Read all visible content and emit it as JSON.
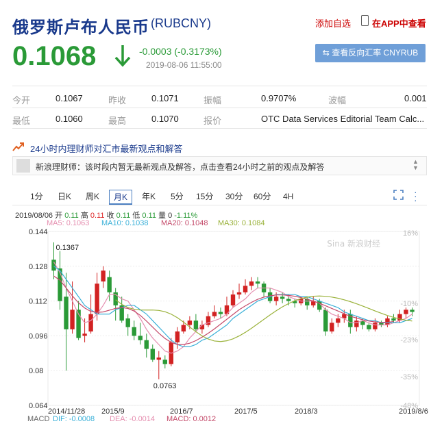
{
  "header": {
    "title": "俄罗斯卢布人民币",
    "code": "(RUBCNY)",
    "add_watch": "添加自选",
    "app_view": "在APP中查看"
  },
  "quote": {
    "price": "0.1068",
    "change": "-0.0003 (-0.3173%)",
    "time": "2019-08-06 11:55:00",
    "reverse_button": "查看反向汇率 CNYRUB"
  },
  "stats": {
    "row1": [
      {
        "label": "今开",
        "value": "0.1067"
      },
      {
        "label": "昨收",
        "value": "0.1071"
      },
      {
        "label": "振幅",
        "value": "0.9707%"
      },
      {
        "label": "波幅",
        "value": "0.001"
      }
    ],
    "row2": [
      {
        "label": "最低",
        "value": "0.1060"
      },
      {
        "label": "最高",
        "value": "0.1070"
      },
      {
        "label": "报价",
        "value": "OTC Data Services Editorial Team Calc..."
      }
    ]
  },
  "news": {
    "heading": "24小时内理财师对汇市最新观点和解答",
    "text": "新浪理财师：该时段内暂无最新观点及解答，点击查看24小时之前的观点及解答"
  },
  "tabs": [
    "1分",
    "日K",
    "周K",
    "月K",
    "年K",
    "5分",
    "15分",
    "30分",
    "60分",
    "4H"
  ],
  "active_tab": "月K",
  "ohlc": {
    "date": "2019/08/06",
    "open_label": "开",
    "open": "0.11",
    "high_label": "高",
    "high": "0.11",
    "close_label": "收",
    "close": "0.11",
    "low_label": "低",
    "low": "0.11",
    "vol_label": "量",
    "vol": "0",
    "pct": "-1.11%"
  },
  "ma": [
    {
      "label": "MA5: 0.1063",
      "color": "#e58fb0"
    },
    {
      "label": "MA10: 0.1038",
      "color": "#3ab0d8"
    },
    {
      "label": "MA20: 0.1048",
      "color": "#c44a6a"
    },
    {
      "label": "MA30: 0.1084",
      "color": "#9ab23a"
    }
  ],
  "macd": {
    "label": "MACD",
    "dif": "DIF: -0.0008",
    "dea": "DEA: -0.0014",
    "macd": "MACD: 0.0012"
  },
  "watermark": "新浪财经",
  "colors": {
    "up": "#d22222",
    "down": "#2a9a37",
    "accent": "#1a3a8c"
  },
  "chart_data": {
    "type": "candlestick",
    "y_ticks": [
      "0.144",
      "0.128",
      "0.112",
      "0.096",
      "0.08",
      "0.064"
    ],
    "y_range": [
      0.064,
      0.144
    ],
    "pct_ticks": [
      "16%",
      "-10%",
      "-23%",
      "-35%",
      "-48%"
    ],
    "x_ticks": [
      "2014/11/28",
      "2015/9",
      "2016/7",
      "2017/5",
      "2018/3",
      "2019/8/6"
    ],
    "annotations": [
      {
        "label": "0.1367",
        "value": 0.1367
      },
      {
        "label": "0.0763",
        "value": 0.0763
      }
    ],
    "candles": [
      [
        0.131,
        0.126,
        0.139,
        0.122
      ],
      [
        0.127,
        0.112,
        0.135,
        0.108
      ],
      [
        0.114,
        0.099,
        0.125,
        0.08
      ],
      [
        0.099,
        0.108,
        0.121,
        0.097
      ],
      [
        0.108,
        0.095,
        0.112,
        0.094
      ],
      [
        0.096,
        0.097,
        0.104,
        0.093
      ],
      [
        0.098,
        0.106,
        0.115,
        0.097
      ],
      [
        0.106,
        0.12,
        0.125,
        0.103
      ],
      [
        0.121,
        0.126,
        0.128,
        0.118
      ],
      [
        0.123,
        0.116,
        0.126,
        0.112
      ],
      [
        0.116,
        0.11,
        0.118,
        0.103
      ],
      [
        0.11,
        0.103,
        0.114,
        0.102
      ],
      [
        0.104,
        0.1,
        0.106,
        0.096
      ],
      [
        0.1,
        0.096,
        0.103,
        0.094
      ],
      [
        0.096,
        0.094,
        0.102,
        0.092
      ],
      [
        0.094,
        0.09,
        0.097,
        0.086
      ],
      [
        0.09,
        0.085,
        0.092,
        0.084
      ],
      [
        0.085,
        0.086,
        0.089,
        0.076
      ],
      [
        0.085,
        0.083,
        0.087,
        0.081
      ],
      [
        0.083,
        0.093,
        0.095,
        0.082
      ],
      [
        0.093,
        0.098,
        0.1,
        0.09
      ],
      [
        0.098,
        0.101,
        0.103,
        0.097
      ],
      [
        0.101,
        0.103,
        0.105,
        0.099
      ],
      [
        0.103,
        0.099,
        0.106,
        0.098
      ],
      [
        0.099,
        0.101,
        0.103,
        0.097
      ],
      [
        0.101,
        0.105,
        0.107,
        0.1
      ],
      [
        0.105,
        0.107,
        0.11,
        0.104
      ],
      [
        0.107,
        0.106,
        0.109,
        0.104
      ],
      [
        0.106,
        0.11,
        0.114,
        0.105
      ],
      [
        0.11,
        0.115,
        0.117,
        0.109
      ],
      [
        0.115,
        0.116,
        0.12,
        0.113
      ],
      [
        0.116,
        0.119,
        0.122,
        0.115
      ],
      [
        0.119,
        0.121,
        0.123,
        0.117
      ],
      [
        0.121,
        0.12,
        0.123,
        0.118
      ],
      [
        0.12,
        0.116,
        0.121,
        0.114
      ],
      [
        0.116,
        0.112,
        0.118,
        0.111
      ],
      [
        0.112,
        0.114,
        0.116,
        0.11
      ],
      [
        0.114,
        0.113,
        0.116,
        0.111
      ],
      [
        0.113,
        0.112,
        0.115,
        0.11
      ],
      [
        0.112,
        0.111,
        0.113,
        0.109
      ],
      [
        0.111,
        0.113,
        0.114,
        0.11
      ],
      [
        0.113,
        0.11,
        0.114,
        0.108
      ],
      [
        0.11,
        0.112,
        0.114,
        0.109
      ],
      [
        0.112,
        0.108,
        0.113,
        0.107
      ],
      [
        0.108,
        0.098,
        0.109,
        0.096
      ],
      [
        0.098,
        0.102,
        0.104,
        0.097
      ],
      [
        0.102,
        0.104,
        0.106,
        0.1
      ],
      [
        0.104,
        0.106,
        0.108,
        0.102
      ],
      [
        0.106,
        0.1,
        0.108,
        0.097
      ],
      [
        0.1,
        0.103,
        0.105,
        0.098
      ],
      [
        0.103,
        0.101,
        0.104,
        0.099
      ],
      [
        0.101,
        0.099,
        0.102,
        0.098
      ],
      [
        0.099,
        0.102,
        0.104,
        0.098
      ],
      [
        0.102,
        0.101,
        0.103,
        0.1
      ],
      [
        0.101,
        0.104,
        0.105,
        0.1
      ],
      [
        0.104,
        0.103,
        0.106,
        0.102
      ],
      [
        0.103,
        0.106,
        0.108,
        0.102
      ],
      [
        0.106,
        0.108,
        0.109,
        0.104
      ],
      [
        0.108,
        0.107,
        0.109,
        0.105
      ]
    ],
    "ma5": [
      0.13,
      0.125,
      0.118,
      0.112,
      0.106,
      0.102,
      0.103,
      0.106,
      0.11,
      0.115,
      0.115,
      0.113,
      0.112,
      0.108,
      0.104,
      0.099,
      0.095,
      0.092,
      0.089,
      0.088,
      0.089,
      0.091,
      0.095,
      0.098,
      0.101,
      0.102,
      0.103,
      0.104,
      0.106,
      0.109,
      0.111,
      0.113,
      0.116,
      0.118,
      0.118,
      0.118,
      0.117,
      0.116,
      0.114,
      0.113,
      0.112,
      0.112,
      0.112,
      0.111,
      0.108,
      0.106,
      0.105,
      0.104,
      0.102,
      0.102,
      0.103,
      0.102,
      0.101,
      0.101,
      0.101,
      0.102,
      0.103,
      0.104,
      0.106
    ],
    "ma10": [
      0.128,
      0.126,
      0.122,
      0.118,
      0.114,
      0.11,
      0.108,
      0.106,
      0.106,
      0.106,
      0.108,
      0.109,
      0.11,
      0.11,
      0.108,
      0.106,
      0.103,
      0.1,
      0.097,
      0.094,
      0.092,
      0.091,
      0.091,
      0.092,
      0.094,
      0.095,
      0.097,
      0.099,
      0.101,
      0.104,
      0.106,
      0.108,
      0.11,
      0.112,
      0.113,
      0.114,
      0.115,
      0.115,
      0.115,
      0.115,
      0.114,
      0.114,
      0.113,
      0.112,
      0.111,
      0.11,
      0.109,
      0.107,
      0.106,
      0.105,
      0.104,
      0.103,
      0.103,
      0.102,
      0.102,
      0.102,
      0.102,
      0.103,
      0.104
    ]
  }
}
